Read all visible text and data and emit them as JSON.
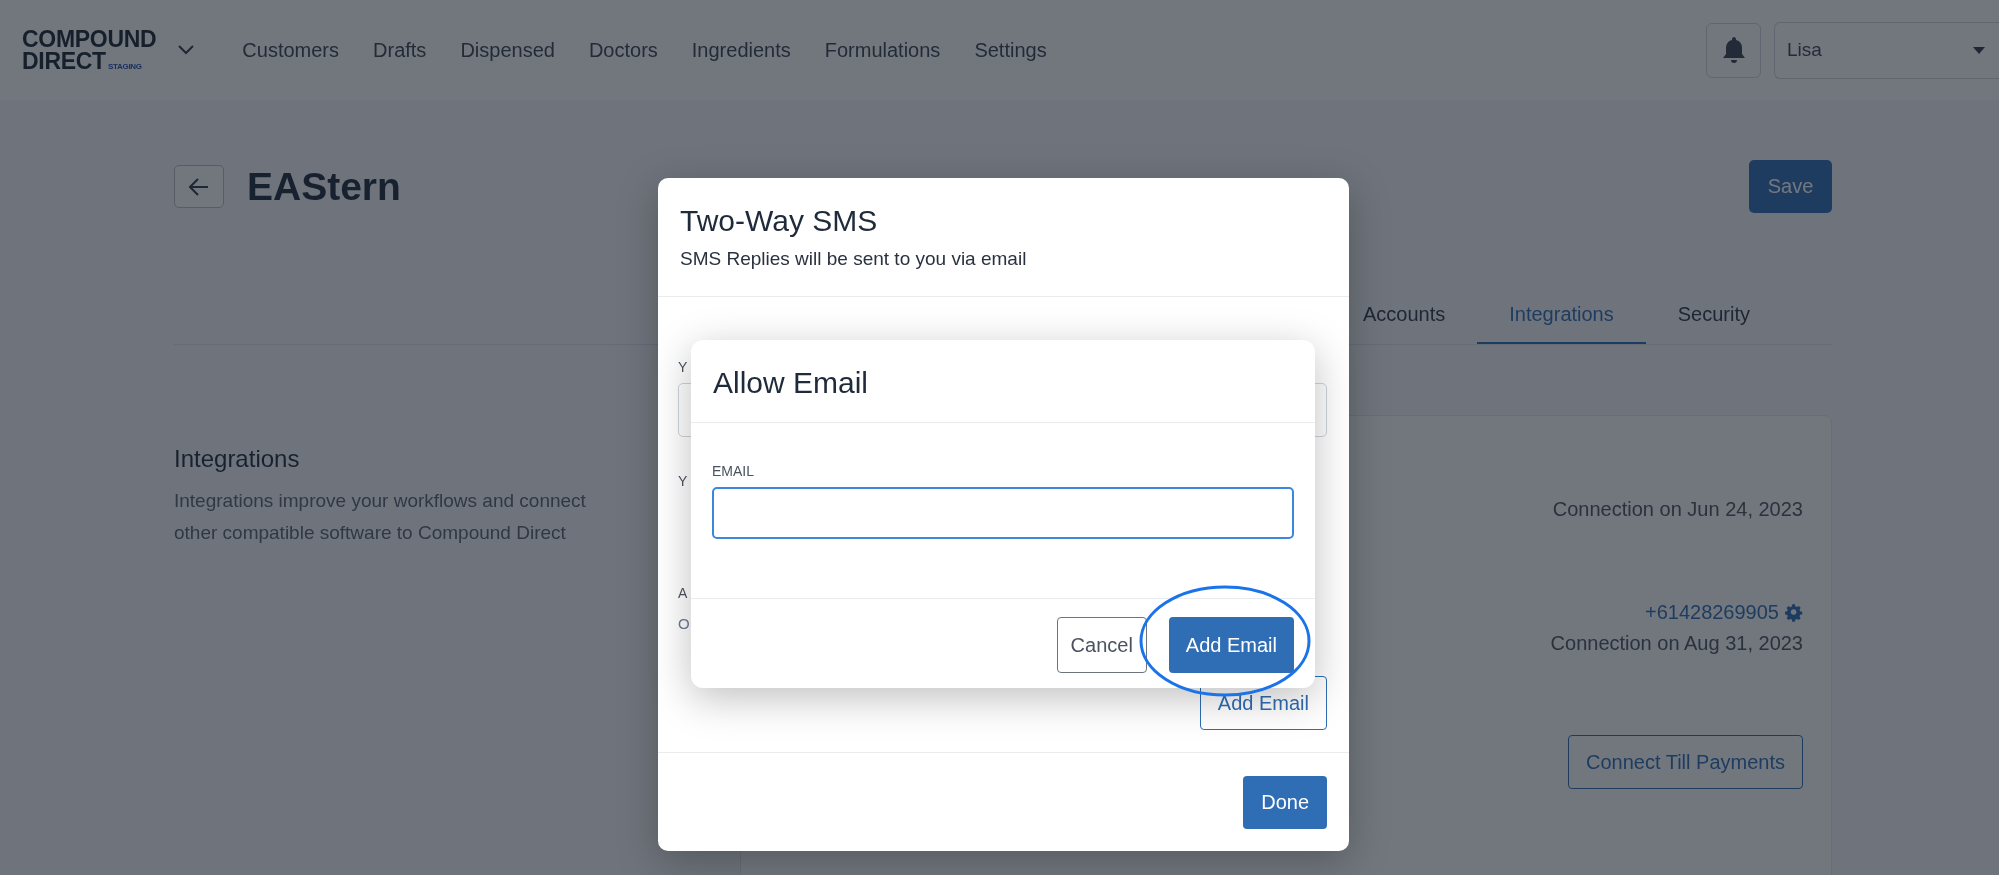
{
  "header": {
    "logo": {
      "line1": "COMPOUND",
      "line2": "DIRECT",
      "tag": "STAGING"
    },
    "nav": [
      "Customers",
      "Drafts",
      "Dispensed",
      "Doctors",
      "Ingredients",
      "Formulations",
      "Settings"
    ],
    "user": "Lisa"
  },
  "page": {
    "title": "EAStern",
    "save_button": "Save",
    "tabs": [
      {
        "label": "Accounts",
        "selected": false
      },
      {
        "label": "Integrations",
        "selected": true
      },
      {
        "label": "Security",
        "selected": false
      }
    ],
    "section": {
      "heading": "Integrations",
      "description": [
        "Integrations improve your workflows and connect",
        "other compatible software to Compound Direct"
      ]
    },
    "card": {
      "connections": [
        {
          "date": "Connection on Jun 24, 2023"
        },
        {
          "phone": "+61428269905",
          "date": "Connection on Aug 31, 2023"
        }
      ],
      "connect_button": "Connect Till Payments"
    }
  },
  "sms_dialog": {
    "title": "Two-Way SMS",
    "subtitle": "SMS Replies will be sent to you via email",
    "labels": [
      "Y",
      "Y",
      "A"
    ],
    "value": "O",
    "add_email_button": "Add Email",
    "done_button": "Done"
  },
  "email_dialog": {
    "title": "Allow Email",
    "field_label": "EMAIL",
    "cancel_button": "Cancel",
    "add_button": "Add Email"
  }
}
